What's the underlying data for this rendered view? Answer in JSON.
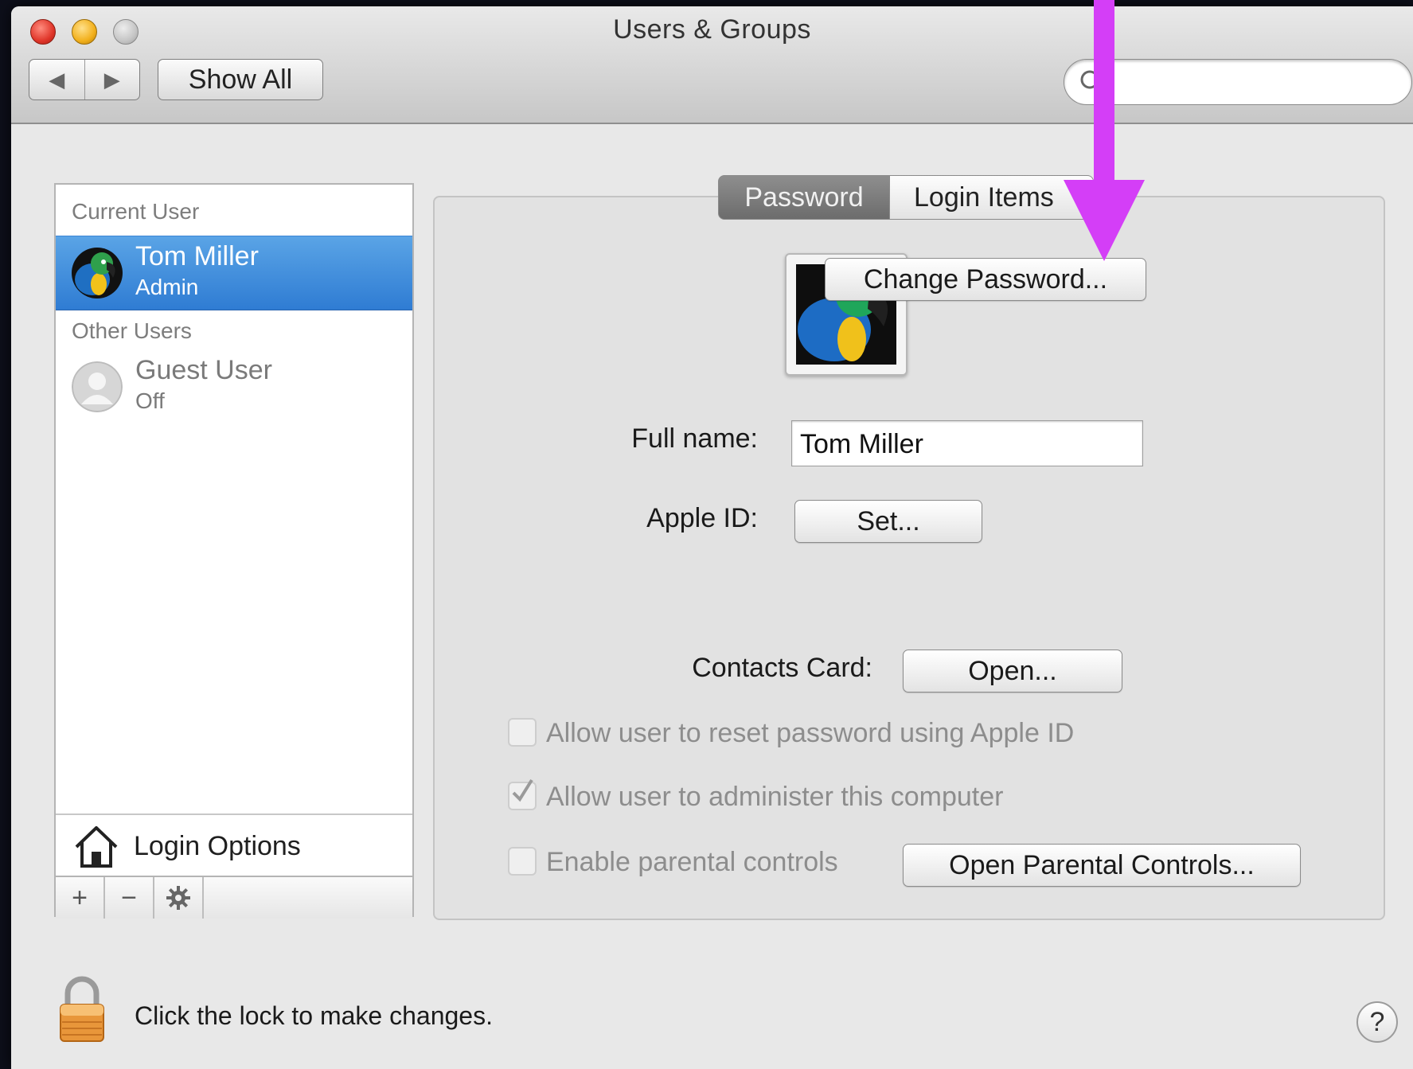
{
  "window": {
    "title": "Users & Groups"
  },
  "toolbar": {
    "back_icon": "◀",
    "forward_icon": "▶",
    "show_all_label": "Show All",
    "search_placeholder": ""
  },
  "sidebar": {
    "current_user_label": "Current User",
    "current_user": {
      "name": "Tom Miller",
      "role": "Admin"
    },
    "other_users_label": "Other Users",
    "other_users": [
      {
        "name": "Guest User",
        "role": "Off"
      }
    ],
    "login_options_label": "Login Options",
    "add_label": "+",
    "remove_label": "−"
  },
  "tabs": [
    {
      "label": "Password",
      "active": true
    },
    {
      "label": "Login Items",
      "active": false
    }
  ],
  "main": {
    "change_password_label": "Change Password...",
    "full_name_label": "Full name:",
    "full_name_value": "Tom Miller",
    "apple_id_label": "Apple ID:",
    "apple_id_button": "Set...",
    "contacts_card_label": "Contacts Card:",
    "contacts_card_button": "Open...",
    "options": [
      {
        "label": "Allow user to reset password using Apple ID",
        "checked": false
      },
      {
        "label": "Allow user to administer this computer",
        "checked": true
      },
      {
        "label": "Enable parental controls",
        "checked": false
      }
    ],
    "parental_controls_button": "Open Parental Controls..."
  },
  "footer": {
    "lock_text": "Click the lock to make changes.",
    "help_label": "?"
  },
  "annotation": {
    "arrow_color": "#d43ef7"
  }
}
